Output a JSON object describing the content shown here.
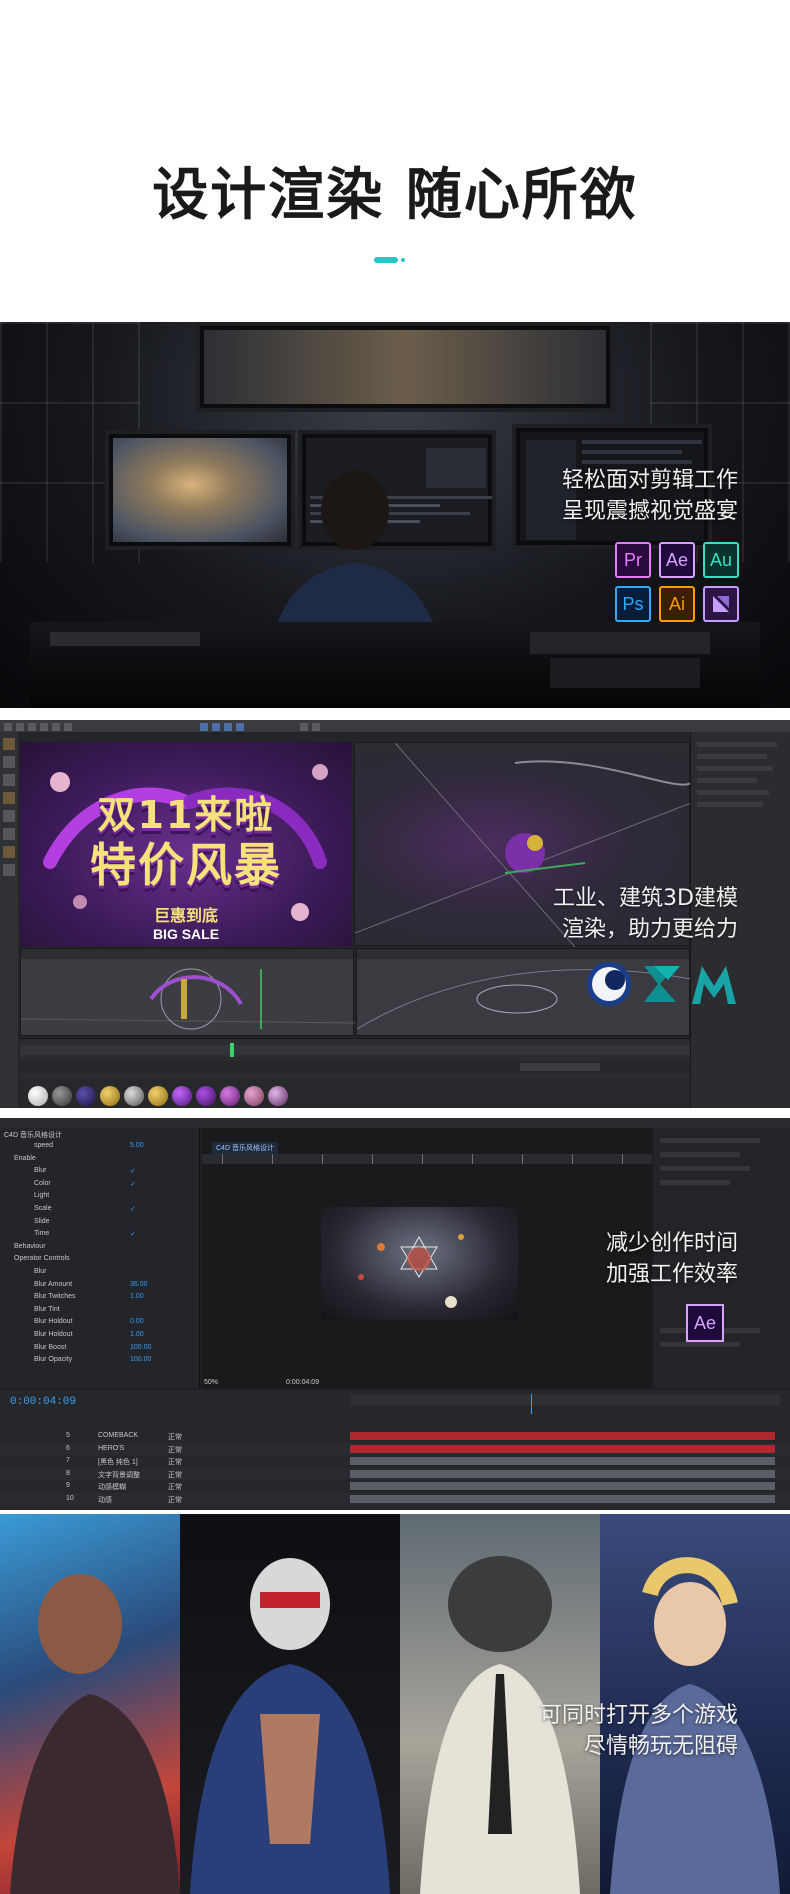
{
  "header": {
    "title": "设计渲染 随心所欲"
  },
  "panels": {
    "editing": {
      "caption_line1": "轻松面对剪辑工作",
      "caption_line2": "呈现震撼视觉盛宴",
      "apps": [
        {
          "label": "Pr",
          "color": "#e77cff",
          "bg": "#2a0a3d"
        },
        {
          "label": "Ae",
          "color": "#d6a3ff",
          "bg": "#1f0a3b"
        },
        {
          "label": "Au",
          "color": "#35e0c4",
          "bg": "#07332c"
        },
        {
          "label": "Ps",
          "color": "#31a8ff",
          "bg": "#061e3a"
        },
        {
          "label": "Ai",
          "color": "#ff9a00",
          "bg": "#3a1f00"
        },
        {
          "label": "",
          "color": "#c59cff",
          "bg": "#2a1545"
        }
      ]
    },
    "modeling": {
      "caption_line1": "工业、建筑3D建模",
      "caption_line2": "渲染，助力更给力",
      "promo_line1": "双11来啦",
      "promo_line2": "特价风暴",
      "promo_line3": "巨惠到底",
      "promo_sub": "BIG SALE",
      "logos": [
        "cinema4d-logo",
        "3dsmax-logo",
        "maya-logo"
      ]
    },
    "motion": {
      "caption_line1": "减少创作时间",
      "caption_line2": "加强工作效率",
      "app_badge": "Ae",
      "comp_tab": "C4D 音乐风格设计",
      "timecode": "0:00:04:09",
      "zoom": "50%",
      "effect_rows": [
        {
          "name": "speed",
          "value": "5.00"
        },
        {
          "name": "Enable",
          "value": ""
        },
        {
          "name": "Blur",
          "value": "✓"
        },
        {
          "name": "Color",
          "value": "✓"
        },
        {
          "name": "Light",
          "value": ""
        },
        {
          "name": "Scale",
          "value": "✓"
        },
        {
          "name": "Slide",
          "value": ""
        },
        {
          "name": "Time",
          "value": "✓"
        },
        {
          "name": "Behaviour",
          "value": ""
        },
        {
          "name": "Operator Controls",
          "value": ""
        },
        {
          "name": "Blur",
          "value": ""
        },
        {
          "name": "Blur Amount",
          "value": "36.00"
        },
        {
          "name": "Blur Twitches",
          "value": "1.00"
        },
        {
          "name": "Blur Tint",
          "value": ""
        },
        {
          "name": "Blur Holdout",
          "value": "0.00"
        },
        {
          "name": "Blur Holdout",
          "value": "1.00"
        },
        {
          "name": "Blur Boost",
          "value": "100.00"
        },
        {
          "name": "Blur Opacity",
          "value": "100.00"
        }
      ],
      "layers": [
        {
          "num": "5",
          "name": "COMEBACK",
          "mode": "正常",
          "color": "#b0282e"
        },
        {
          "num": "6",
          "name": "HERO'S",
          "mode": "正常",
          "color": "#b0282e"
        },
        {
          "num": "7",
          "name": "[黑色 纯色 1]",
          "mode": "正常",
          "color": "#5c5e66"
        },
        {
          "num": "8",
          "name": "文字背景调整",
          "mode": "正常",
          "color": "#5c5e66"
        },
        {
          "num": "9",
          "name": "动感模糊",
          "mode": "正常",
          "color": "#5c5e66"
        },
        {
          "num": "10",
          "name": "动感",
          "mode": "正常",
          "color": "#5c5e66"
        }
      ]
    },
    "gaming": {
      "caption_line1": "可同时打开多个游戏",
      "caption_line2": "尽情畅玩无阻碍"
    }
  }
}
